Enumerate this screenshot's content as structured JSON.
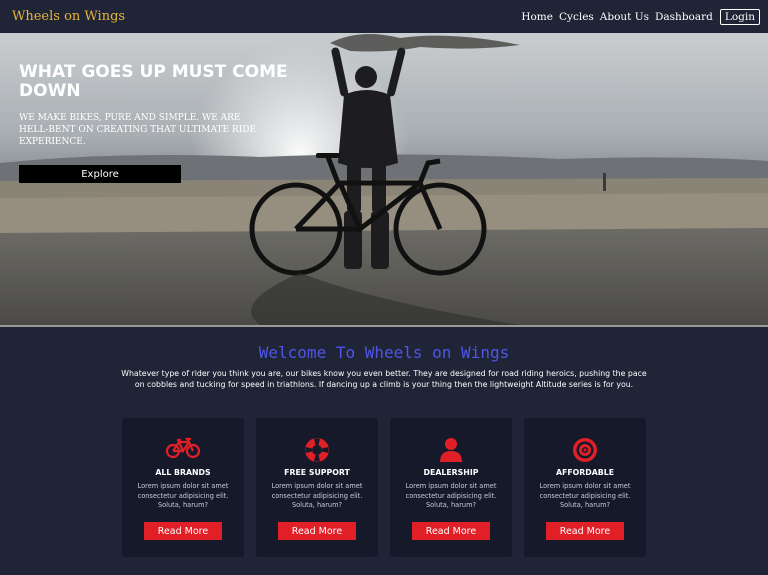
{
  "nav": {
    "brand": "Wheels on Wings",
    "links": [
      "Home",
      "Cycles",
      "About Us",
      "Dashboard"
    ],
    "login": "Login"
  },
  "hero": {
    "title": "WHAT GOES UP MUST COME DOWN",
    "subtitle": "WE MAKE BIKES, PURE AND SIMPLE. WE ARE HELL-BENT ON CREATING THAT ULTIMATE RIDE EXPERIENCE.",
    "button": "Explore"
  },
  "welcome": {
    "title": "Welcome To Wheels on Wings",
    "text": "Whatever type of rider you think you are, our bikes know you even better. They are designed for road riding heroics, pushing the pace on cobbles and tucking for speed in triathlons. If dancing up a climb is your thing then the lightweight Altitude series is for you."
  },
  "colors": {
    "accent": "#e01f27",
    "brand": "#e7b53a",
    "welcome": "#4f56e6",
    "background": "#1f2436",
    "card": "#15192a"
  },
  "cards": [
    {
      "icon": "bicycle-icon",
      "title": "ALL BRANDS",
      "text": "Lorem ipsum dolor sit amet consectetur adipisicing elit. Soluta, harum?",
      "button": "Read More"
    },
    {
      "icon": "lifebuoy-icon",
      "title": "FREE SUPPORT",
      "text": "Lorem ipsum dolor sit amet consectetur adipisicing elit. Soluta, harum?",
      "button": "Read More"
    },
    {
      "icon": "user-icon",
      "title": "DEALERSHIP",
      "text": "Lorem ipsum dolor sit amet consectetur adipisicing elit. Soluta, harum?",
      "button": "Read More"
    },
    {
      "icon": "target-icon",
      "title": "AFFORDABLE",
      "text": "Lorem ipsum dolor sit amet consectetur adipisicing elit. Soluta, harum?",
      "button": "Read More"
    }
  ]
}
